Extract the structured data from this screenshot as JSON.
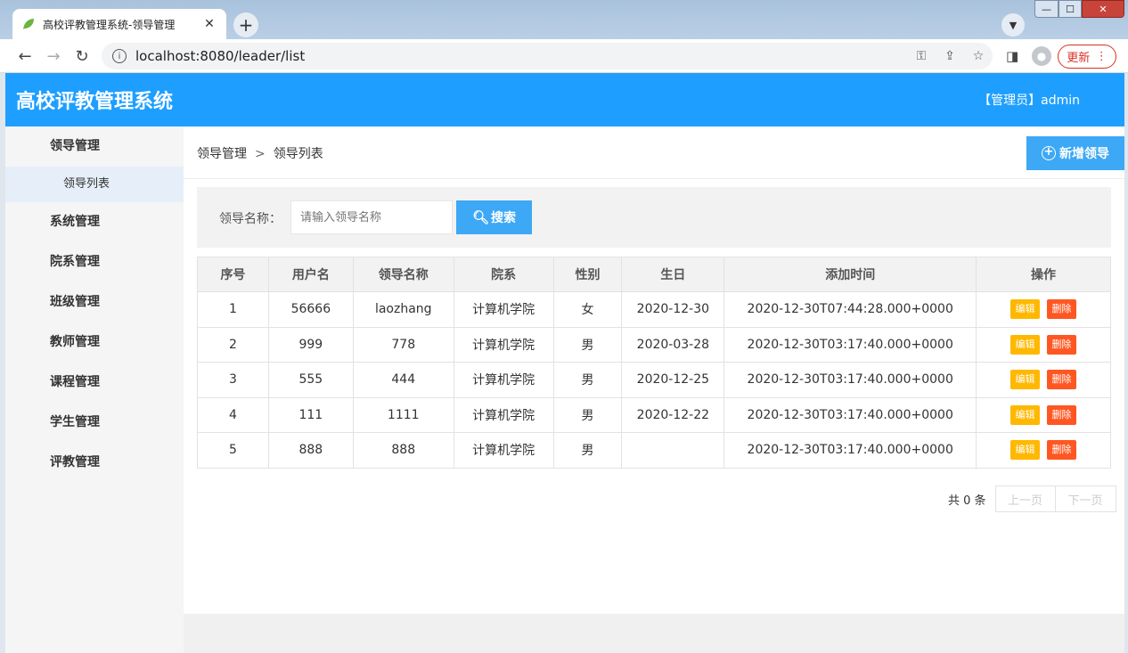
{
  "browser": {
    "tab_title": "高校评教管理系统-领导管理",
    "tab_close": "✕",
    "new_tab": "+",
    "url": "localhost:8080/leader/list",
    "update_label": "更新",
    "update_menu": "⋮",
    "min": "—",
    "max": "☐",
    "close": "✕"
  },
  "app": {
    "title": "高校评教管理系统",
    "user": "【管理员】admin"
  },
  "sidebar": {
    "items": [
      {
        "label": "领导管理"
      },
      {
        "label": "领导列表"
      },
      {
        "label": "系统管理"
      },
      {
        "label": "院系管理"
      },
      {
        "label": "班级管理"
      },
      {
        "label": "教师管理"
      },
      {
        "label": "课程管理"
      },
      {
        "label": "学生管理"
      },
      {
        "label": "评教管理"
      }
    ]
  },
  "breadcrumb": {
    "parent": "领导管理",
    "separator": ">",
    "current": "领导列表"
  },
  "add_button": "新增领导",
  "search": {
    "label": "领导名称：",
    "placeholder": "请输入领导名称",
    "button": "搜索"
  },
  "table": {
    "headers": [
      "序号",
      "用户名",
      "领导名称",
      "院系",
      "性别",
      "生日",
      "添加时间",
      "操作"
    ],
    "rows": [
      [
        "1",
        "56666",
        "laozhang",
        "计算机学院",
        "女",
        "2020-12-30",
        "2020-12-30T07:44:28.000+0000"
      ],
      [
        "2",
        "999",
        "778",
        "计算机学院",
        "男",
        "2020-03-28",
        "2020-12-30T03:17:40.000+0000"
      ],
      [
        "3",
        "555",
        "444",
        "计算机学院",
        "男",
        "2020-12-25",
        "2020-12-30T03:17:40.000+0000"
      ],
      [
        "4",
        "111",
        "1111",
        "计算机学院",
        "男",
        "2020-12-22",
        "2020-12-30T03:17:40.000+0000"
      ],
      [
        "5",
        "888",
        "888",
        "计算机学院",
        "男",
        "",
        "2020-12-30T03:17:40.000+0000"
      ]
    ],
    "edit_label": "编辑",
    "delete_label": "删除"
  },
  "pager": {
    "total": "共 0 条",
    "prev": "上一页",
    "next": "下一页"
  }
}
